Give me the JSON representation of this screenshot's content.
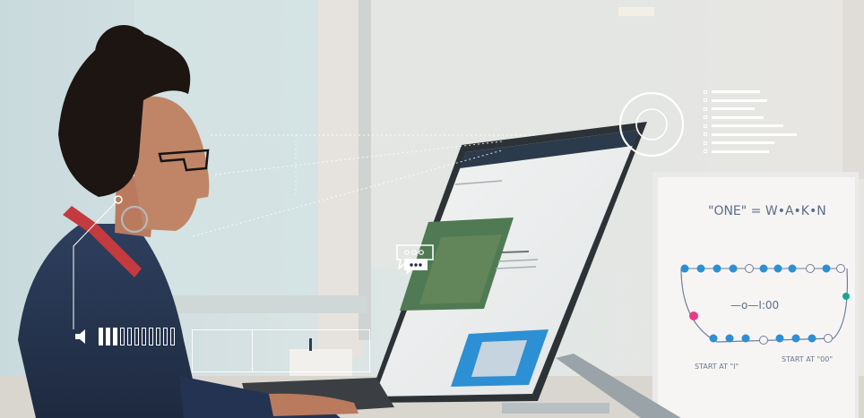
{
  "image": {
    "kind": "photo-composite",
    "volume": {
      "level_fraction": 0.27,
      "segments": 11
    },
    "icons": [
      "speaker-icon",
      "chat-bubble-icon",
      "target-ring-icon",
      "checklist-icon"
    ],
    "colors": {
      "accent_blue": "#2d8fd4",
      "whiteboard_pink": "#e63b8a",
      "whiteboard_teal": "#1aa58f",
      "overlay_white": "#ffffff"
    },
    "whiteboard": {
      "heading": "\"ONE\" = W•A•K•N",
      "middle": "—o—I:00",
      "caption_left": "START AT \"I\"",
      "caption_right": "START AT \"00\""
    }
  }
}
